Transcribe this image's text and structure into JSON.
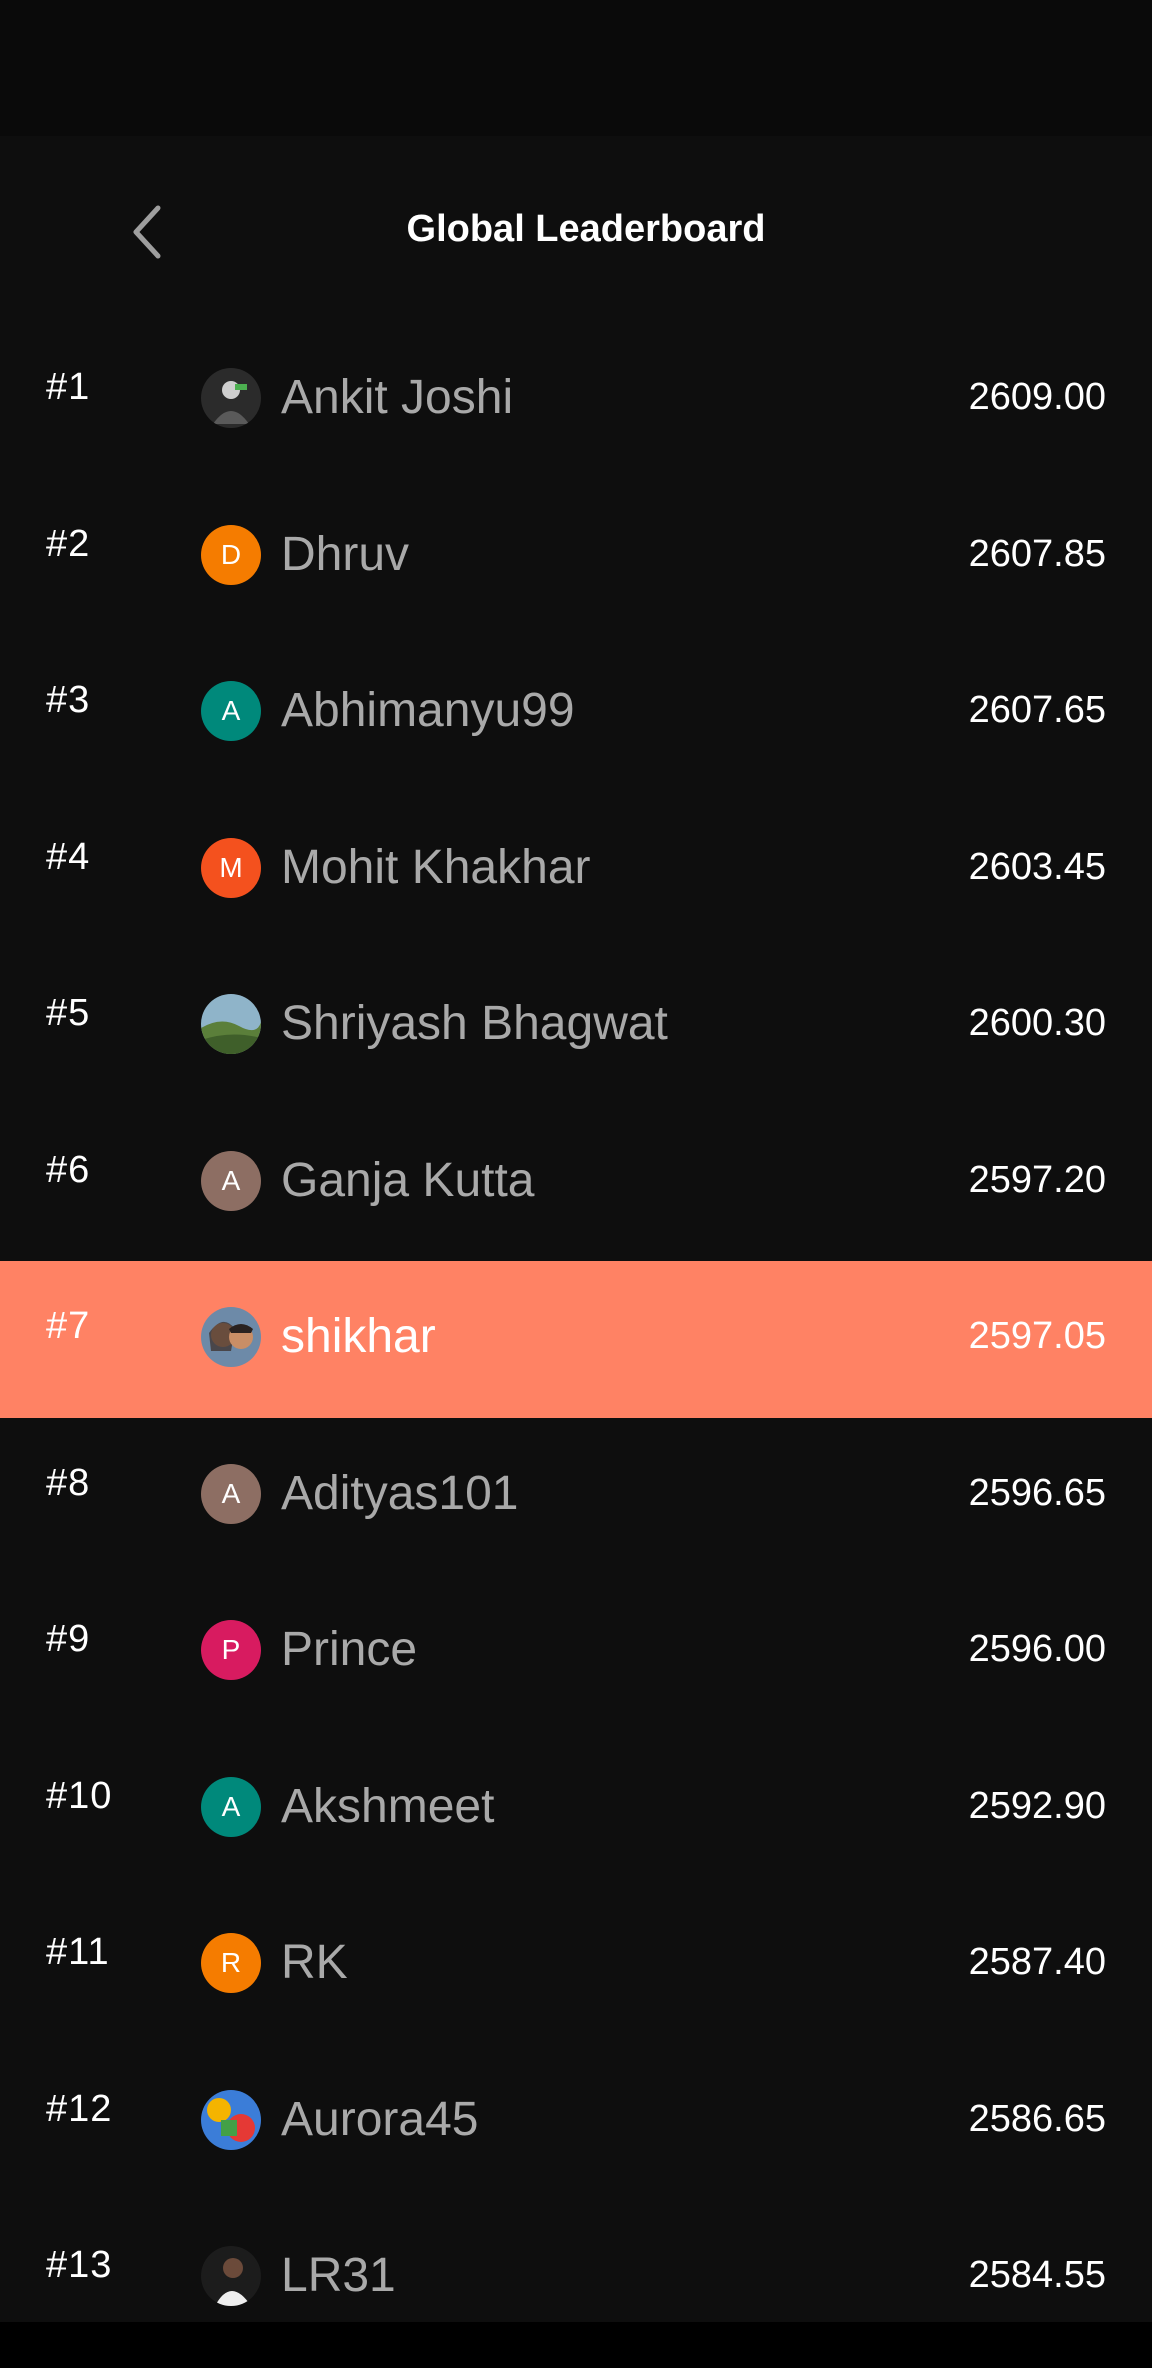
{
  "header": {
    "title": "Global Leaderboard",
    "back_icon": "chevron-left-icon"
  },
  "colors": {
    "background": "#0e0e0e",
    "highlight_row": "#ff8264",
    "name_text": "#a9a9a9",
    "text": "#ffffff"
  },
  "leaderboard": [
    {
      "rank": "#1",
      "name": "Ankit Joshi",
      "score": "2609.00",
      "avatar": {
        "type": "photo",
        "icon": "user-photo-icon"
      }
    },
    {
      "rank": "#2",
      "name": "Dhruv",
      "score": "2607.85",
      "avatar": {
        "type": "letter",
        "letter": "D",
        "color": "#f57c00"
      }
    },
    {
      "rank": "#3",
      "name": "Abhimanyu99",
      "score": "2607.65",
      "avatar": {
        "type": "letter",
        "letter": "A",
        "color": "#00897b"
      }
    },
    {
      "rank": "#4",
      "name": "Mohit Khakhar",
      "score": "2603.45",
      "avatar": {
        "type": "letter",
        "letter": "M",
        "color": "#f4511e"
      }
    },
    {
      "rank": "#5",
      "name": "Shriyash Bhagwat",
      "score": "2600.30",
      "avatar": {
        "type": "photo",
        "icon": "landscape-photo-icon"
      }
    },
    {
      "rank": "#6",
      "name": "Ganja Kutta",
      "score": "2597.20",
      "avatar": {
        "type": "letter",
        "letter": "A",
        "color": "#8d6e63"
      }
    },
    {
      "rank": "#7",
      "name": "shikhar",
      "score": "2597.05",
      "avatar": {
        "type": "photo",
        "icon": "couple-photo-icon"
      },
      "current_user": true
    },
    {
      "rank": "#8",
      "name": "Adityas101",
      "score": "2596.65",
      "avatar": {
        "type": "letter",
        "letter": "A",
        "color": "#8d6e63"
      }
    },
    {
      "rank": "#9",
      "name": "Prince",
      "score": "2596.00",
      "avatar": {
        "type": "letter",
        "letter": "P",
        "color": "#d81b60"
      }
    },
    {
      "rank": "#10",
      "name": "Akshmeet",
      "score": "2592.90",
      "avatar": {
        "type": "letter",
        "letter": "A",
        "color": "#00897b"
      }
    },
    {
      "rank": "#11",
      "name": "RK",
      "score": "2587.40",
      "avatar": {
        "type": "letter",
        "letter": "R",
        "color": "#f57c00"
      }
    },
    {
      "rank": "#12",
      "name": "Aurora45",
      "score": "2586.65",
      "avatar": {
        "type": "photo",
        "icon": "colorful-photo-icon"
      }
    },
    {
      "rank": "#13",
      "name": "LR31",
      "score": "2584.55",
      "avatar": {
        "type": "photo",
        "icon": "person-photo-icon"
      }
    }
  ]
}
